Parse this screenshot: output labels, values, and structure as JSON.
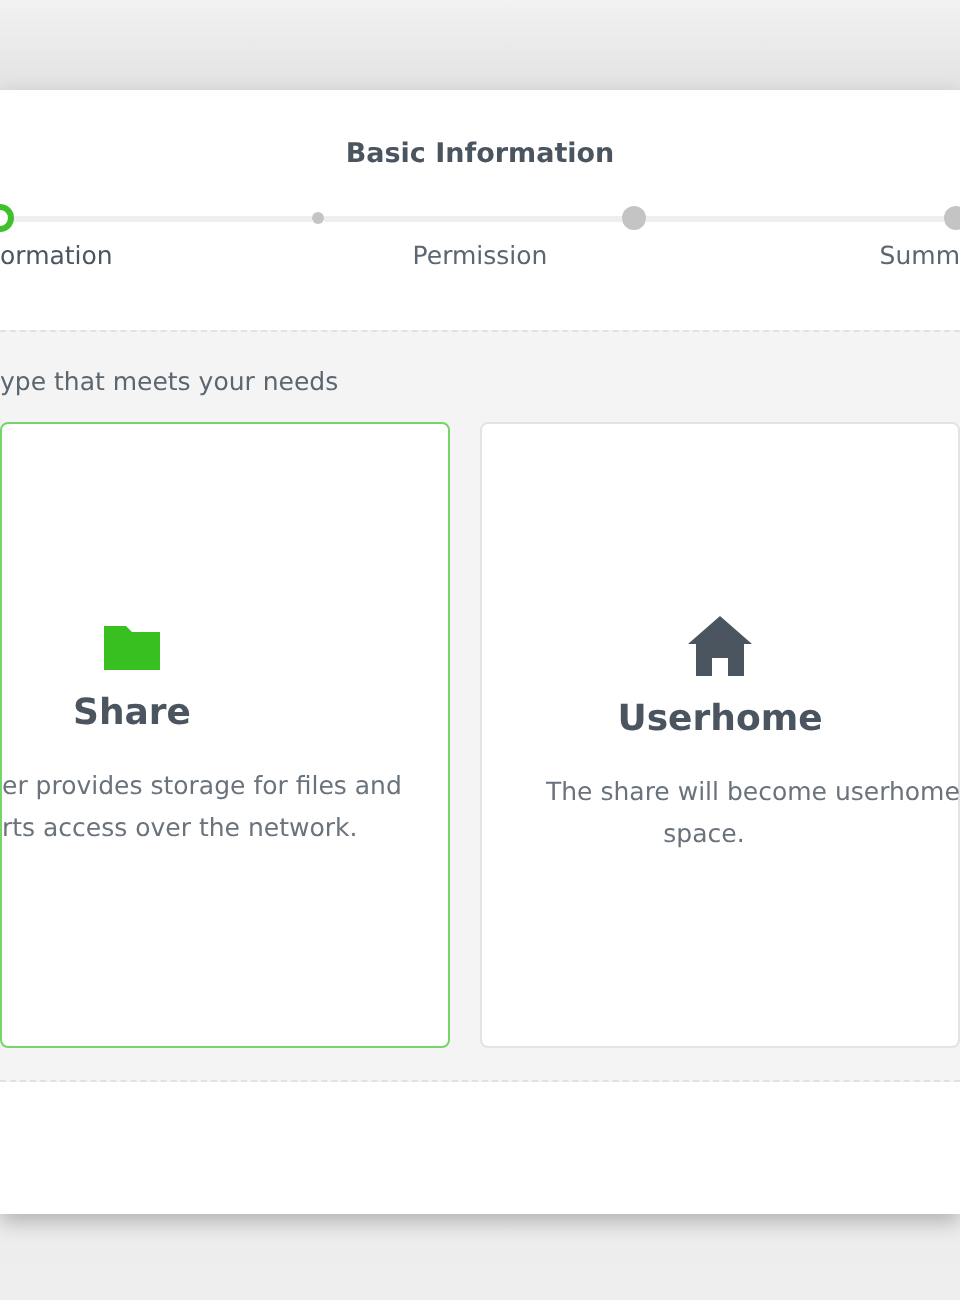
{
  "dialog": {
    "title": "Basic Information",
    "steps": [
      {
        "kind": "major",
        "label": "ormation",
        "current": true
      },
      {
        "kind": "minor",
        "current": false
      },
      {
        "kind": "major",
        "label": "Permission",
        "current": false
      },
      {
        "kind": "major",
        "label": "Summ",
        "current": false
      }
    ],
    "prompt": "ype that meets your needs",
    "cards": [
      {
        "title": "Share",
        "selected": true,
        "description": [
          "er provides storage for files and",
          "rts access over the network."
        ]
      },
      {
        "title": "Userhome",
        "selected": false,
        "description": [
          "The share will become userhome",
          "space."
        ]
      }
    ]
  }
}
